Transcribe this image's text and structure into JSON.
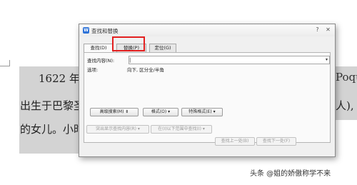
{
  "document": {
    "line1": "1622 年",
    "line1_right": "Poque",
    "line2": "出生于巴黎圣",
    "line2_right": "人),",
    "line3": "的女儿。小时"
  },
  "dialog": {
    "app_icon_letter": "W",
    "title": "查找和替换",
    "help_glyph": "?",
    "close_glyph": "✕",
    "tabs": [
      {
        "label": "查找(D)"
      },
      {
        "label": "替换(P)"
      },
      {
        "label": "定位(G)"
      }
    ],
    "find_label": "查找内容(N):",
    "find_value": "",
    "dropdown_glyph": "▾",
    "options_label": "选项:",
    "options_value": "向下, 区分全/半角",
    "buttons": {
      "advanced": "高级搜索(M) ⇟",
      "format": "格式(O) ▾",
      "special": "特殊格式(E) ▾",
      "highlight_all": "突出显示查找内容(R) ▾",
      "find_in": "在(I)以下范围中查找(I) ▾",
      "find_prev": "查找上一处(B)",
      "find_next": "查找下一处(F)"
    }
  },
  "watermark": "头条 @姐的娇傲称学不来"
}
